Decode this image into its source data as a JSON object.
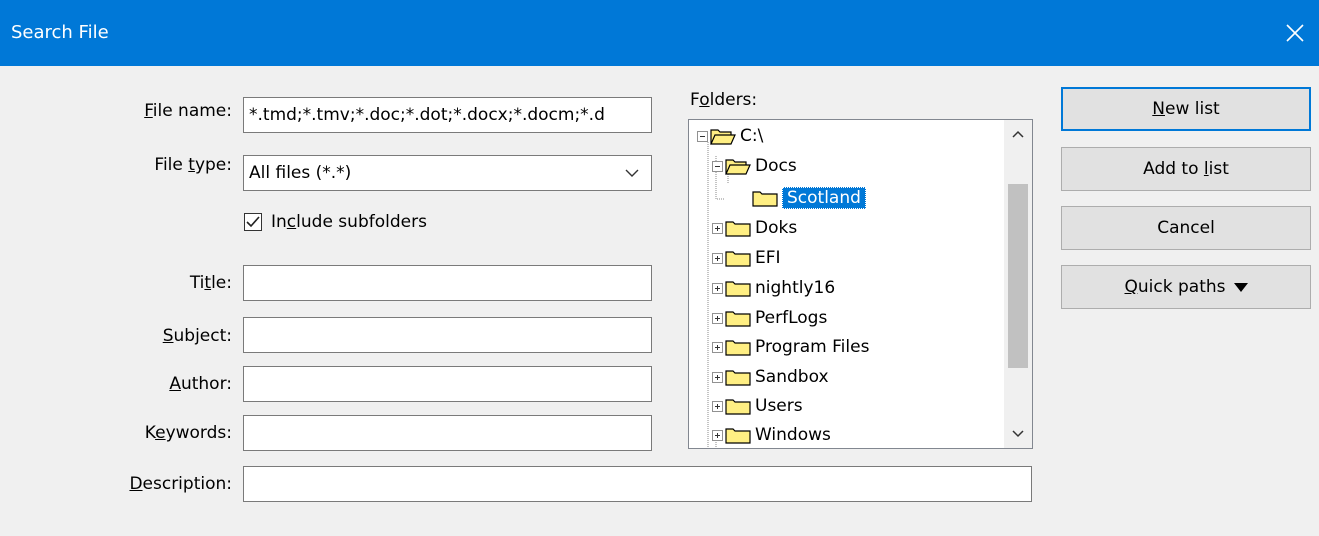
{
  "window": {
    "title": "Search File"
  },
  "form": {
    "file_name": {
      "label_pre": "",
      "label_u": "F",
      "label_post": "ile name:",
      "value": "*.tmd;*.tmv;*.doc;*.dot;*.docx;*.docm;*.d"
    },
    "file_type": {
      "label_pre": "File ",
      "label_u": "t",
      "label_post": "ype:",
      "value": "All files (*.*)"
    },
    "include_subfolders": {
      "label_pre": "In",
      "label_u": "c",
      "label_post": "lude subfolders",
      "checked": true
    },
    "title": {
      "label_pre": "Ti",
      "label_u": "t",
      "label_post": "le:",
      "value": ""
    },
    "subject": {
      "label_pre": "",
      "label_u": "S",
      "label_post": "ubject:",
      "value": ""
    },
    "author": {
      "label_pre": "",
      "label_u": "A",
      "label_post": "uthor:",
      "value": ""
    },
    "keywords": {
      "label_pre": "K",
      "label_u": "e",
      "label_post": "ywords:",
      "value": ""
    },
    "description": {
      "label_pre": "",
      "label_u": "D",
      "label_post": "escription:",
      "value": ""
    }
  },
  "folders": {
    "label_pre": "F",
    "label_u": "o",
    "label_post": "lders:",
    "tree": [
      {
        "label": "C:\\",
        "level": 0,
        "expanded": true,
        "has_toggle": true,
        "open_icon": true
      },
      {
        "label": "Docs",
        "level": 1,
        "expanded": true,
        "has_toggle": true,
        "open_icon": true
      },
      {
        "label": "Scotland",
        "level": 2,
        "selected": true,
        "has_toggle": false
      },
      {
        "label": "Doks",
        "level": 1,
        "has_toggle": true
      },
      {
        "label": "EFI",
        "level": 1,
        "has_toggle": true
      },
      {
        "label": "nightly16",
        "level": 1,
        "has_toggle": true
      },
      {
        "label": "PerfLogs",
        "level": 1,
        "has_toggle": true
      },
      {
        "label": "Program Files",
        "level": 1,
        "has_toggle": true
      },
      {
        "label": "Sandbox",
        "level": 1,
        "has_toggle": true
      },
      {
        "label": "Users",
        "level": 1,
        "has_toggle": true
      },
      {
        "label": "Windows",
        "level": 1,
        "has_toggle": true
      }
    ]
  },
  "buttons": {
    "new_list": {
      "pre": "",
      "u": "N",
      "post": "ew list"
    },
    "add_to_list": {
      "pre": "Add to ",
      "u": "l",
      "post": "ist"
    },
    "cancel": {
      "pre": "Cancel",
      "u": "",
      "post": ""
    },
    "quick_paths": {
      "pre": "",
      "u": "Q",
      "post": "uick paths"
    }
  },
  "colors": {
    "titlebar": "#0078d7",
    "selection": "#0078d7",
    "folder": "#ffef83"
  }
}
